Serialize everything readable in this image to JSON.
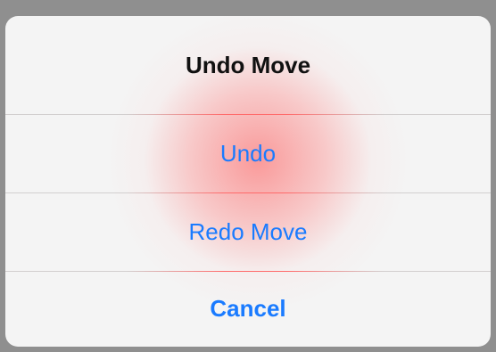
{
  "sheet": {
    "title": "Undo Move",
    "actions": [
      {
        "label": "Undo"
      },
      {
        "label": "Redo Move"
      },
      {
        "label": "Cancel"
      }
    ]
  },
  "colors": {
    "action_blue": "#1a7bff",
    "title_black": "#111111",
    "backdrop_gray": "#8f8f8f",
    "sheet_bg": "#f4f4f4",
    "highlight_red": "#ff5050"
  }
}
